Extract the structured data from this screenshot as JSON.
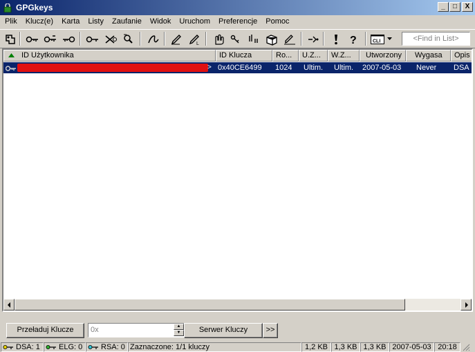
{
  "window": {
    "title": "GPGkeys",
    "controls": {
      "minimize": "_",
      "maximize": "□",
      "close": "X"
    }
  },
  "menu": [
    "Plik",
    "Klucz(e)",
    "Karta",
    "Listy",
    "Zaufanie",
    "Widok",
    "Uruchom",
    "Preferencje",
    "Pomoc"
  ],
  "toolbar": {
    "icons": [
      "key-ring-icon",
      "import-key-icon",
      "export-key-icon",
      "generate-key-icon",
      "key-icon",
      "delete-key-icon",
      "search-key-icon",
      "sign-key-icon",
      "edit-key-icon",
      "edit-key-local-icon",
      "trust-icon",
      "key-properties-icon",
      "key-servers-icon",
      "card-icon",
      "edit-user-icon",
      "refresh-icon",
      "warning-icon",
      "help-icon",
      "cli-icon"
    ],
    "cli_label": "CLI",
    "find_placeholder": "<Find in List>"
  },
  "table": {
    "columns": [
      "ID Użytkownika",
      "ID Klucza",
      "Ro...",
      "U.Z...",
      "W.Z...",
      "Utworzony",
      "Wygasa",
      "Opis"
    ],
    "rows": [
      {
        "key_id": "0x40CE6499",
        "size": "1024",
        "user_trust": "Ultim.",
        "key_trust": "Ultim.",
        "created": "2007-05-03",
        "expires": "Never",
        "desc": "DSA"
      }
    ]
  },
  "bottom": {
    "reload_button": "Przeładuj Klucze",
    "number_value": "0x",
    "server_button": "Serwer Kluczy",
    "more_button": ">>"
  },
  "status": {
    "dsa": "DSA: 1",
    "elg": "ELG: 0",
    "rsa": "RSA: 0",
    "selected": "Zaznaczone: 1/1 kluczy",
    "size1": "1,2 KB",
    "size2": "1,3 KB",
    "size3": "1,3 KB",
    "date": "2007-05-03",
    "time": "20:18"
  },
  "colors": {
    "title_bar": "#0a246a",
    "selection": "#0a246a",
    "redaction": "#e01010",
    "face": "#d4d0c8"
  }
}
